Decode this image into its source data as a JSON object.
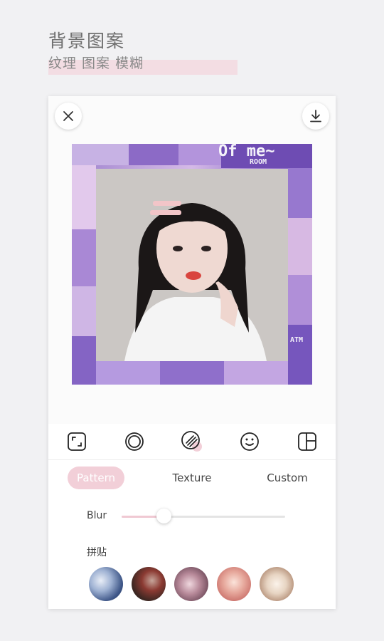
{
  "header": {
    "title": "背景图案",
    "subtitle": "纹理 图案 模糊"
  },
  "top_bar": {
    "close_icon": "close-icon",
    "download_icon": "download-icon"
  },
  "collage": {
    "texts": [
      "Of me~",
      "ROOM",
      "ATM"
    ]
  },
  "toolbar": {
    "icons": [
      "crop-icon",
      "frame-ring-icon",
      "pattern-stripes-icon",
      "sticker-smile-icon",
      "layout-grid-icon"
    ],
    "active_index": 2
  },
  "tabs": {
    "items": [
      "Pattern",
      "Texture",
      "Custom"
    ],
    "active": "Pattern"
  },
  "blur": {
    "label": "Blur",
    "value": 0.26
  },
  "section": {
    "label": "拼贴"
  },
  "colors": {
    "accent_pink": "#f2cfd8",
    "collage_purple": "#9e7fd0",
    "background": "#f1f1f3"
  },
  "thumbnails": [
    "blue-collage-thumb",
    "dark-red-collage-thumb",
    "mauve-collage-thumb",
    "peach-collage-thumb",
    "beige-collage-thumb"
  ]
}
